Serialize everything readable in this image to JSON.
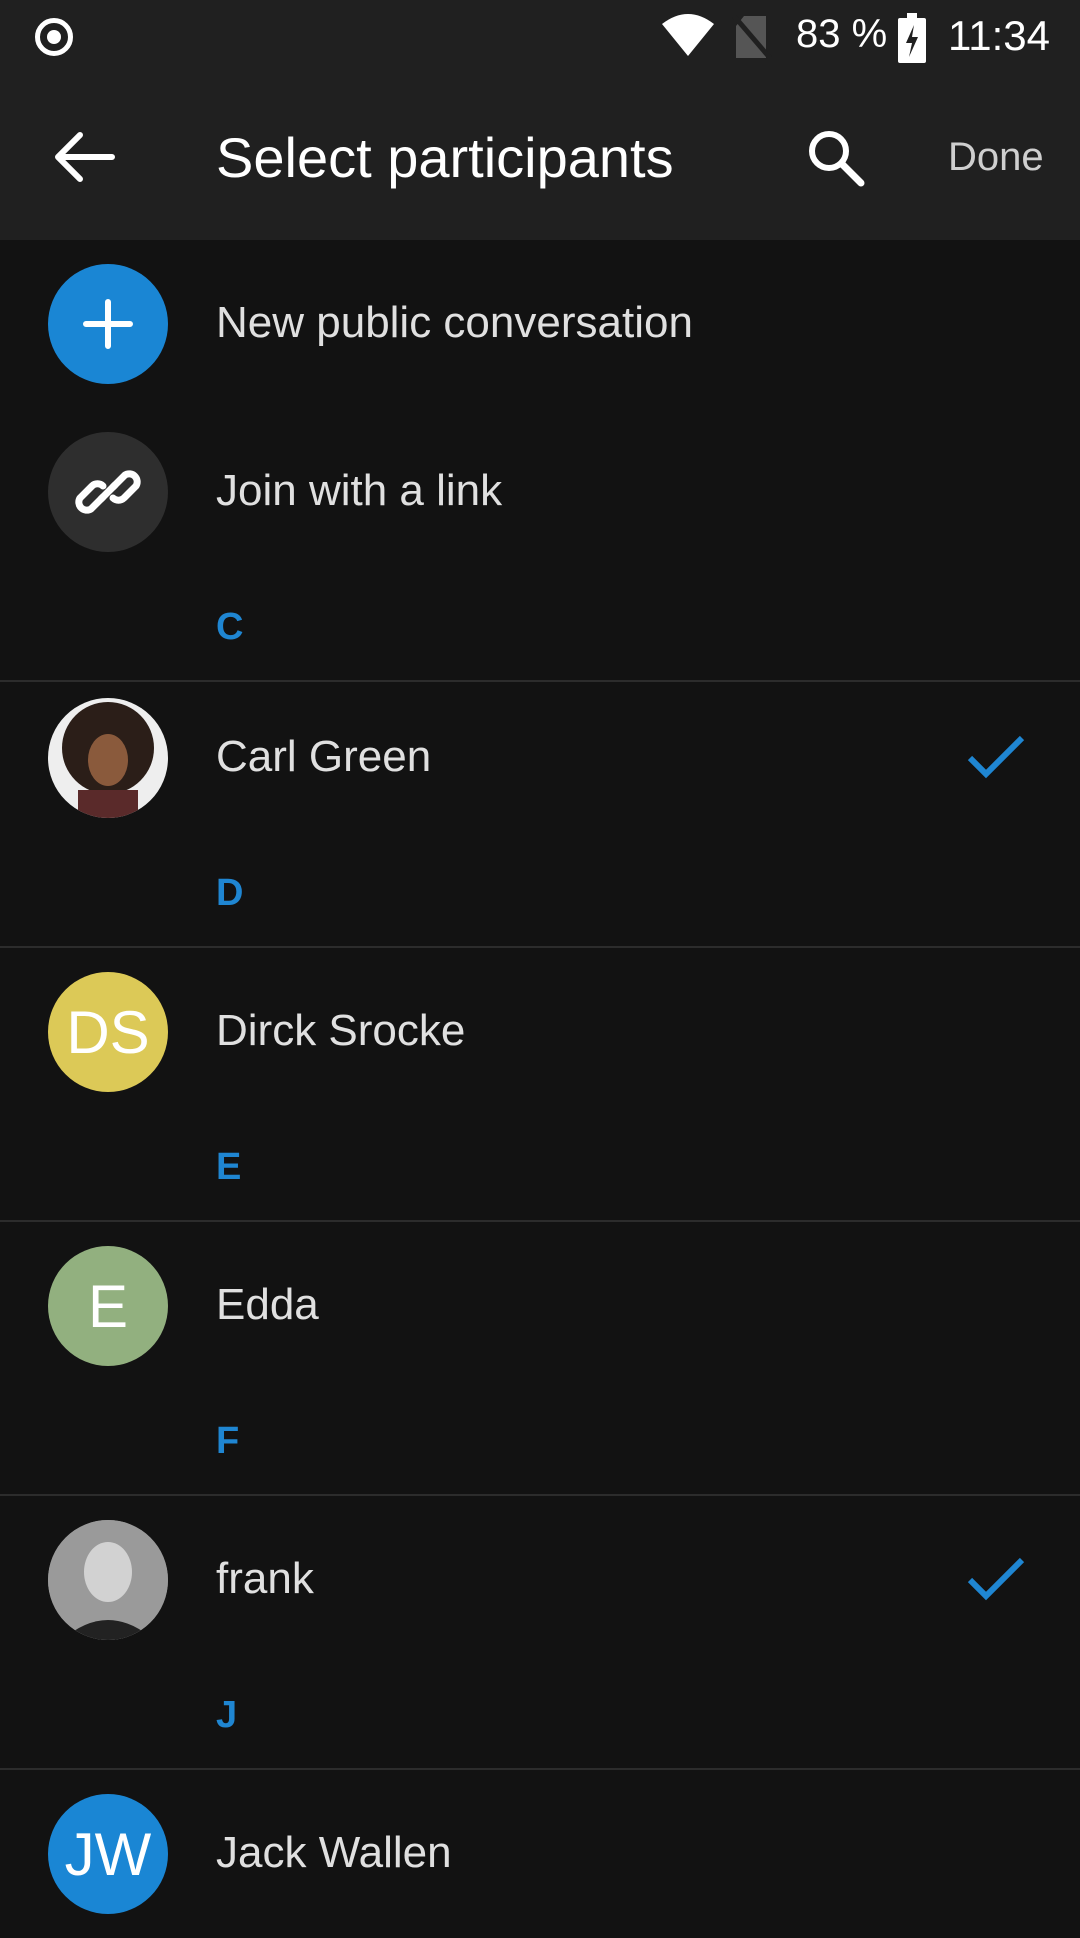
{
  "status_bar": {
    "battery_percent": "83 %",
    "time": "11:34"
  },
  "app_bar": {
    "title": "Select participants",
    "done_label": "Done"
  },
  "actions": [
    {
      "label": "New public conversation",
      "icon": "plus-icon",
      "color": "#1a86d4"
    },
    {
      "label": "Join with a link",
      "icon": "link-icon",
      "color": "#2e2e2e"
    }
  ],
  "contacts": [
    {
      "section": "C",
      "name": "Carl Green",
      "avatar": "photo",
      "initials": "",
      "color": "#5a2a2a",
      "selected": true
    },
    {
      "section": "D",
      "name": "Dirck Srocke",
      "avatar": "initials",
      "initials": "DS",
      "color": "#dcc957",
      "selected": false
    },
    {
      "section": "E",
      "name": "Edda",
      "avatar": "initials",
      "initials": "E",
      "color": "#92b07f",
      "selected": false
    },
    {
      "section": "F",
      "name": "frank",
      "avatar": "photo",
      "initials": "",
      "color": "#6b6b6b",
      "selected": true
    },
    {
      "section": "J",
      "name": "Jack Wallen",
      "avatar": "initials",
      "initials": "JW",
      "color": "#1a86d4",
      "selected": false
    }
  ],
  "colors": {
    "accent": "#1f86d2",
    "background": "#121212",
    "app_bar": "#202020"
  }
}
